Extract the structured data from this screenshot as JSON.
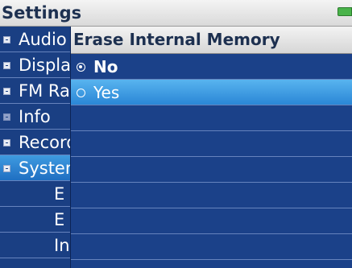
{
  "titlebar": {
    "title": "Settings",
    "battery_icon": "battery-icon"
  },
  "menu": {
    "items": [
      {
        "label": "Audio",
        "bullet": "expand-icon",
        "selected": false,
        "sub": false
      },
      {
        "label": "Display",
        "bullet": "expand-icon",
        "selected": false,
        "sub": false
      },
      {
        "label": "FM Radio",
        "bullet": "expand-icon",
        "selected": false,
        "sub": false
      },
      {
        "label": "Info",
        "bullet": "leaf-icon",
        "selected": false,
        "sub": false
      },
      {
        "label": "Record",
        "bullet": "expand-icon",
        "selected": false,
        "sub": false
      },
      {
        "label": "System",
        "bullet": "collapse-icon",
        "selected": true,
        "sub": false
      },
      {
        "label": "E",
        "bullet": "",
        "selected": false,
        "sub": true
      },
      {
        "label": "E",
        "bullet": "",
        "selected": false,
        "sub": true
      },
      {
        "label": "In",
        "bullet": "",
        "selected": false,
        "sub": true
      }
    ]
  },
  "dialog": {
    "title": "Erase Internal Memory",
    "options": [
      {
        "label": "No",
        "checked": true,
        "highlighted": false
      },
      {
        "label": "Yes",
        "checked": false,
        "highlighted": true
      }
    ]
  },
  "colors": {
    "background": "#1a3f83",
    "highlight": "#2a86d6",
    "titlebar": "#e6e6e6",
    "title_text": "#1d3050"
  }
}
